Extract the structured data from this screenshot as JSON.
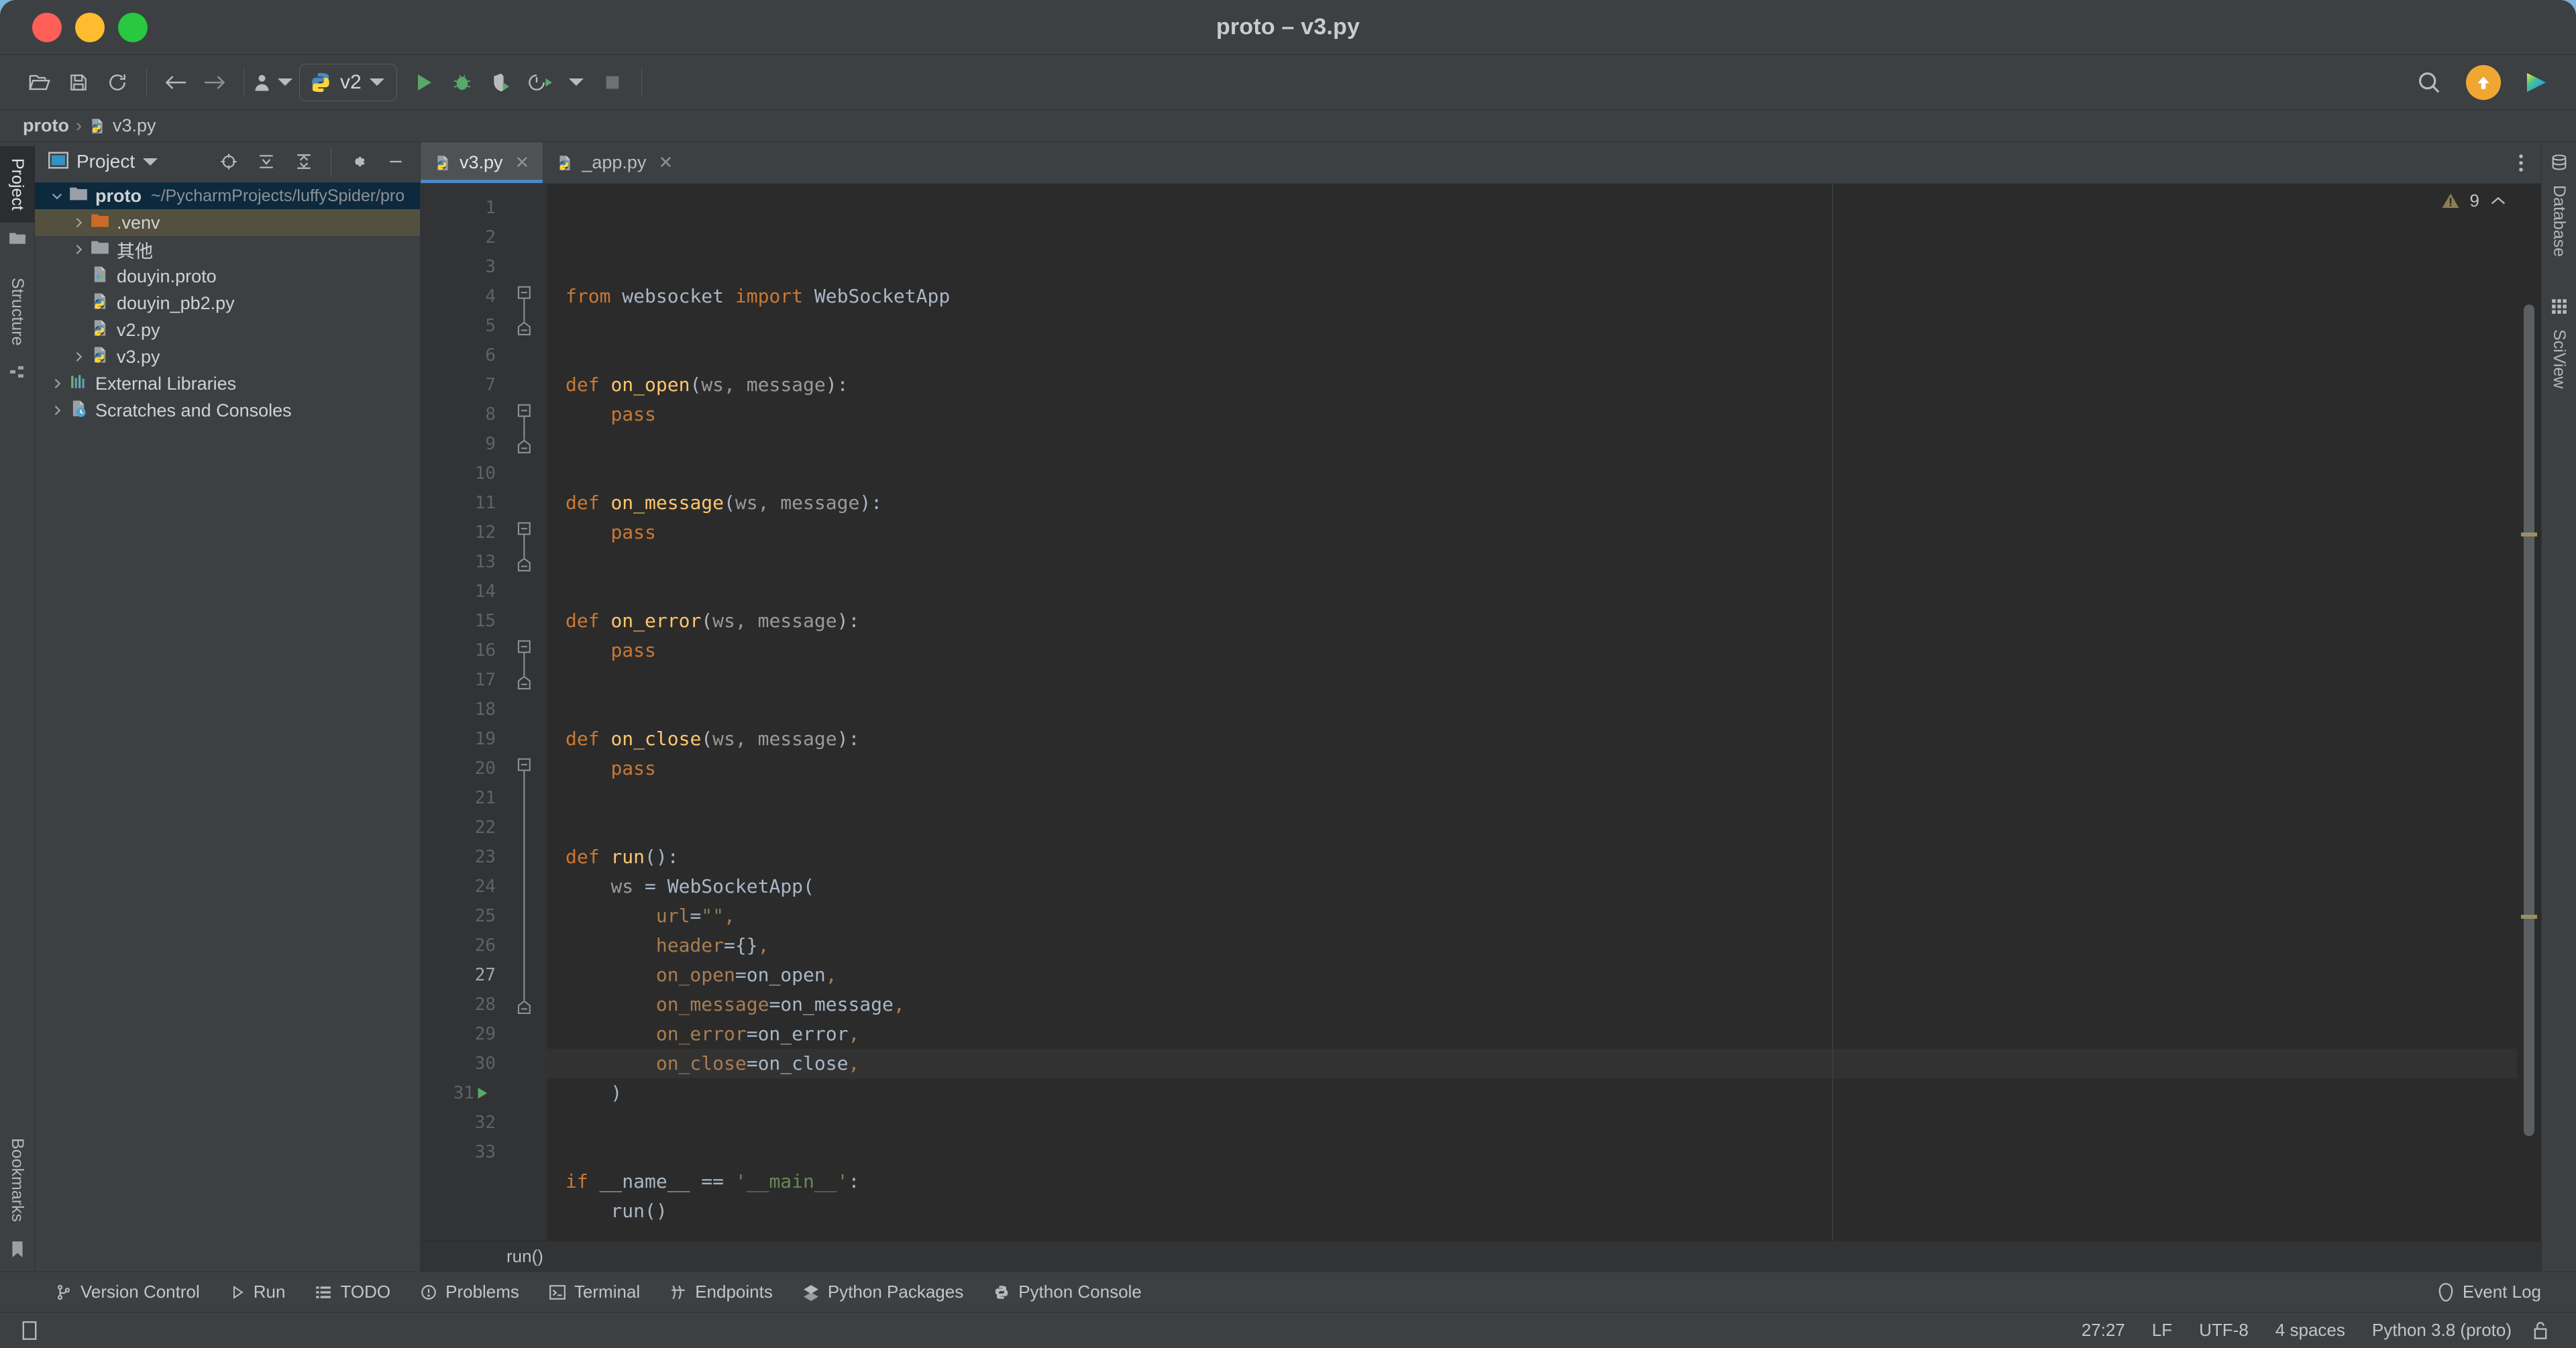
{
  "window": {
    "title": "proto – v3.py",
    "traffic_lights": [
      "close",
      "minimize",
      "zoom"
    ]
  },
  "toolbar": {
    "icons": [
      {
        "name": "open-folder-icon",
        "label": "Open"
      },
      {
        "name": "save-icon",
        "label": "Save All"
      },
      {
        "name": "sync-icon",
        "label": "Reload from Disk"
      },
      {
        "name": "back-arrow-icon",
        "label": "Back"
      },
      {
        "name": "forward-arrow-icon",
        "label": "Forward"
      },
      {
        "name": "profile-icon",
        "label": "Profile"
      }
    ],
    "run_config": {
      "label": "v2",
      "icon": "python-icon"
    },
    "actions": [
      {
        "name": "run-icon",
        "label": "Run"
      },
      {
        "name": "debug-icon",
        "label": "Debug"
      },
      {
        "name": "run-coverage-icon",
        "label": "Run with Coverage"
      },
      {
        "name": "profiler-icon",
        "label": "Profile"
      },
      {
        "name": "stop-icon",
        "label": "Stop"
      }
    ],
    "search_icon": "search-icon",
    "update_badge": "update-arrow-icon",
    "app_logo": "jetbrains-logo-icon"
  },
  "breadcrumb": {
    "items": [
      "proto",
      "v3.py"
    ],
    "separator": "›"
  },
  "left_rail": {
    "items": [
      {
        "label": "Project",
        "icon": "project-icon",
        "active": true
      },
      {
        "label": "Structure",
        "icon": "structure-icon",
        "active": false
      }
    ],
    "bottom": [
      {
        "label": "Bookmarks",
        "icon": "bookmark-icon",
        "active": false
      }
    ]
  },
  "right_rail": {
    "items": [
      {
        "label": "Database",
        "icon": "database-icon"
      },
      {
        "label": "SciView",
        "icon": "sciview-icon"
      }
    ]
  },
  "project_panel": {
    "title": "Project",
    "header_icons": [
      {
        "name": "select-opened-file-icon"
      },
      {
        "name": "expand-all-icon"
      },
      {
        "name": "collapse-all-icon"
      },
      {
        "name": "gear-icon"
      },
      {
        "name": "hide-icon"
      }
    ],
    "tree": [
      {
        "label": "proto",
        "path": "~/PycharmProjects/luffySpider/pro",
        "icon": "folder-icon",
        "arrow": "expanded",
        "indent": 0,
        "bold": true,
        "selected": "blue"
      },
      {
        "label": ".venv",
        "path": "",
        "icon": "folder-orange-icon",
        "arrow": "collapsed",
        "indent": 1,
        "bold": false,
        "selected": "olive"
      },
      {
        "label": "其他",
        "path": "",
        "icon": "folder-icon",
        "arrow": "collapsed",
        "indent": 1,
        "bold": false,
        "selected": ""
      },
      {
        "label": "douyin.proto",
        "path": "",
        "icon": "proto-file-icon",
        "arrow": "none",
        "indent": 1,
        "bold": false,
        "selected": ""
      },
      {
        "label": "douyin_pb2.py",
        "path": "",
        "icon": "python-file-icon",
        "arrow": "none",
        "indent": 1,
        "bold": false,
        "selected": ""
      },
      {
        "label": "v2.py",
        "path": "",
        "icon": "python-file-icon",
        "arrow": "none",
        "indent": 1,
        "bold": false,
        "selected": ""
      },
      {
        "label": "v3.py",
        "path": "",
        "icon": "python-file-icon",
        "arrow": "collapsed",
        "indent": 1,
        "bold": false,
        "selected": ""
      },
      {
        "label": "External Libraries",
        "path": "",
        "icon": "libraries-icon",
        "arrow": "collapsed",
        "indent": 0,
        "bold": false,
        "selected": ""
      },
      {
        "label": "Scratches and Consoles",
        "path": "",
        "icon": "scratches-icon",
        "arrow": "collapsed",
        "indent": 0,
        "bold": false,
        "selected": ""
      }
    ]
  },
  "editor": {
    "tabs": [
      {
        "label": "v3.py",
        "icon": "python-file-icon",
        "active": true
      },
      {
        "label": "_app.py",
        "icon": "python-file-icon",
        "active": false
      }
    ],
    "inspections": {
      "icon": "warning-triangle-icon",
      "count": "9",
      "chevron": "chevron-up-icon"
    },
    "current_line": 27,
    "code_breadcrumb": "run()",
    "lines": [
      {
        "n": 1,
        "fold": "none",
        "runmark": false,
        "tokens": [
          {
            "t": "from ",
            "c": "k"
          },
          {
            "t": "websocket ",
            "c": "pm"
          },
          {
            "t": "import ",
            "c": "k"
          },
          {
            "t": "WebSocketApp",
            "c": "pm"
          }
        ]
      },
      {
        "n": 2,
        "fold": "none",
        "runmark": false,
        "tokens": []
      },
      {
        "n": 3,
        "fold": "none",
        "runmark": false,
        "tokens": []
      },
      {
        "n": 4,
        "fold": "start",
        "runmark": false,
        "tokens": [
          {
            "t": "def ",
            "c": "k"
          },
          {
            "t": "on_open",
            "c": "fn"
          },
          {
            "t": "(",
            "c": "pm"
          },
          {
            "t": "ws, message",
            "c": "dim"
          },
          {
            "t": "):",
            "c": "pm"
          }
        ]
      },
      {
        "n": 5,
        "fold": "end",
        "runmark": false,
        "tokens": [
          {
            "t": "    ",
            "c": "pm"
          },
          {
            "t": "pass",
            "c": "k"
          }
        ]
      },
      {
        "n": 6,
        "fold": "none",
        "runmark": false,
        "tokens": []
      },
      {
        "n": 7,
        "fold": "none",
        "runmark": false,
        "tokens": []
      },
      {
        "n": 8,
        "fold": "start",
        "runmark": false,
        "tokens": [
          {
            "t": "def ",
            "c": "k"
          },
          {
            "t": "on_message",
            "c": "fn"
          },
          {
            "t": "(",
            "c": "pm"
          },
          {
            "t": "ws, message",
            "c": "dim"
          },
          {
            "t": "):",
            "c": "pm"
          }
        ]
      },
      {
        "n": 9,
        "fold": "end",
        "runmark": false,
        "tokens": [
          {
            "t": "    ",
            "c": "pm"
          },
          {
            "t": "pass",
            "c": "k"
          }
        ]
      },
      {
        "n": 10,
        "fold": "none",
        "runmark": false,
        "tokens": []
      },
      {
        "n": 11,
        "fold": "none",
        "runmark": false,
        "tokens": []
      },
      {
        "n": 12,
        "fold": "start",
        "runmark": false,
        "tokens": [
          {
            "t": "def ",
            "c": "k"
          },
          {
            "t": "on_error",
            "c": "fn"
          },
          {
            "t": "(",
            "c": "pm"
          },
          {
            "t": "ws, message",
            "c": "dim"
          },
          {
            "t": "):",
            "c": "pm"
          }
        ]
      },
      {
        "n": 13,
        "fold": "end",
        "runmark": false,
        "tokens": [
          {
            "t": "    ",
            "c": "pm"
          },
          {
            "t": "pass",
            "c": "k"
          }
        ]
      },
      {
        "n": 14,
        "fold": "none",
        "runmark": false,
        "tokens": []
      },
      {
        "n": 15,
        "fold": "none",
        "runmark": false,
        "tokens": []
      },
      {
        "n": 16,
        "fold": "start",
        "runmark": false,
        "tokens": [
          {
            "t": "def ",
            "c": "k"
          },
          {
            "t": "on_close",
            "c": "fn"
          },
          {
            "t": "(",
            "c": "pm"
          },
          {
            "t": "ws, message",
            "c": "dim"
          },
          {
            "t": "):",
            "c": "pm"
          }
        ]
      },
      {
        "n": 17,
        "fold": "end",
        "runmark": false,
        "tokens": [
          {
            "t": "    ",
            "c": "pm"
          },
          {
            "t": "pass",
            "c": "k"
          }
        ]
      },
      {
        "n": 18,
        "fold": "none",
        "runmark": false,
        "tokens": []
      },
      {
        "n": 19,
        "fold": "none",
        "runmark": false,
        "tokens": []
      },
      {
        "n": 20,
        "fold": "start",
        "runmark": false,
        "tokens": [
          {
            "t": "def ",
            "c": "k"
          },
          {
            "t": "run",
            "c": "fn"
          },
          {
            "t": "():",
            "c": "pm"
          }
        ]
      },
      {
        "n": 21,
        "fold": "none",
        "runmark": false,
        "tokens": [
          {
            "t": "    ",
            "c": "pm"
          },
          {
            "t": "ws",
            "c": "dim"
          },
          {
            "t": " = WebSocketApp(",
            "c": "pm"
          }
        ]
      },
      {
        "n": 22,
        "fold": "none",
        "runmark": false,
        "tokens": [
          {
            "t": "        ",
            "c": "pm"
          },
          {
            "t": "url",
            "c": "arg"
          },
          {
            "t": "=",
            "c": "pm"
          },
          {
            "t": "\"\"",
            "c": "str"
          },
          {
            "t": ",",
            "c": "arg"
          }
        ]
      },
      {
        "n": 23,
        "fold": "none",
        "runmark": false,
        "tokens": [
          {
            "t": "        ",
            "c": "pm"
          },
          {
            "t": "header",
            "c": "arg"
          },
          {
            "t": "=",
            "c": "pm"
          },
          {
            "t": "{}",
            "c": "pm"
          },
          {
            "t": ",",
            "c": "arg"
          }
        ]
      },
      {
        "n": 24,
        "fold": "none",
        "runmark": false,
        "tokens": [
          {
            "t": "        ",
            "c": "pm"
          },
          {
            "t": "on_open",
            "c": "arg"
          },
          {
            "t": "=",
            "c": "pm"
          },
          {
            "t": "on_open",
            "c": "pm"
          },
          {
            "t": ",",
            "c": "arg"
          }
        ]
      },
      {
        "n": 25,
        "fold": "none",
        "runmark": false,
        "tokens": [
          {
            "t": "        ",
            "c": "pm"
          },
          {
            "t": "on_message",
            "c": "arg"
          },
          {
            "t": "=",
            "c": "pm"
          },
          {
            "t": "on_message",
            "c": "pm"
          },
          {
            "t": ",",
            "c": "arg"
          }
        ]
      },
      {
        "n": 26,
        "fold": "none",
        "runmark": false,
        "tokens": [
          {
            "t": "        ",
            "c": "pm"
          },
          {
            "t": "on_error",
            "c": "arg"
          },
          {
            "t": "=",
            "c": "pm"
          },
          {
            "t": "on_error",
            "c": "pm"
          },
          {
            "t": ",",
            "c": "arg"
          }
        ]
      },
      {
        "n": 27,
        "fold": "none",
        "runmark": false,
        "tokens": [
          {
            "t": "        ",
            "c": "pm"
          },
          {
            "t": "on_close",
            "c": "arg"
          },
          {
            "t": "=",
            "c": "pm"
          },
          {
            "t": "on_close",
            "c": "pm"
          },
          {
            "t": ",",
            "c": "arg"
          }
        ]
      },
      {
        "n": 28,
        "fold": "end",
        "runmark": false,
        "tokens": [
          {
            "t": "    )",
            "c": "pm"
          }
        ]
      },
      {
        "n": 29,
        "fold": "none",
        "runmark": false,
        "tokens": []
      },
      {
        "n": 30,
        "fold": "none",
        "runmark": false,
        "tokens": []
      },
      {
        "n": 31,
        "fold": "none",
        "runmark": true,
        "tokens": [
          {
            "t": "if ",
            "c": "k"
          },
          {
            "t": "__name__ == ",
            "c": "pm"
          },
          {
            "t": "'__main__'",
            "c": "str"
          },
          {
            "t": ":",
            "c": "pm"
          }
        ]
      },
      {
        "n": 32,
        "fold": "none",
        "runmark": false,
        "tokens": [
          {
            "t": "    run()",
            "c": "pm"
          }
        ]
      },
      {
        "n": 33,
        "fold": "none",
        "runmark": false,
        "tokens": []
      }
    ]
  },
  "bottom_bar": {
    "items": [
      {
        "label": "Version Control",
        "icon": "branch-icon"
      },
      {
        "label": "Run",
        "icon": "run-triangle-icon"
      },
      {
        "label": "TODO",
        "icon": "list-icon"
      },
      {
        "label": "Problems",
        "icon": "problems-icon"
      },
      {
        "label": "Terminal",
        "icon": "terminal-icon"
      },
      {
        "label": "Endpoints",
        "icon": "endpoints-icon"
      },
      {
        "label": "Python Packages",
        "icon": "packages-icon"
      },
      {
        "label": "Python Console",
        "icon": "python-console-icon"
      }
    ],
    "event_log": {
      "label": "Event Log",
      "icon": "event-log-icon"
    }
  },
  "status_bar": {
    "left_icon": "toggle-toolwindow-icon",
    "caret_position": "27:27",
    "line_separator": "LF",
    "encoding": "UTF-8",
    "indent": "4 spaces",
    "interpreter": "Python 3.8 (proto)",
    "lock_icon": "unlocked-icon"
  },
  "colors": {
    "accent": "#4a88c7",
    "keyword": "#cc7832",
    "function": "#ffc66d",
    "string": "#6a8759",
    "kwarg": "#aa7d52",
    "plain": "#a9b7c6",
    "editor_bg": "#2b2b2b",
    "panel_bg": "#3c4043",
    "selection_blue": "#0d293e",
    "selection_olive": "#53503f"
  }
}
